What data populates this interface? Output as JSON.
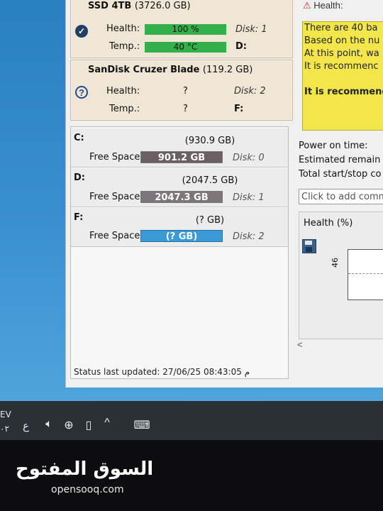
{
  "disks": [
    {
      "name": "SSD 4TB",
      "capacity": "(3726.0 GB)",
      "status_icon": "check-circle-icon",
      "health_label": "Health:",
      "health_value": "100 %",
      "temp_label": "Temp.:",
      "temp_value": "40 °C",
      "disk_label": "Disk: 1",
      "drive_label": "D:"
    },
    {
      "name": "SanDisk Cruzer Blade",
      "capacity": "(119.2 GB)",
      "status_icon": "question-circle-icon",
      "health_label": "Health:",
      "health_value": "?",
      "temp_label": "Temp.:",
      "temp_value": "?",
      "disk_label": "Disk: 2",
      "drive_label": "F:"
    }
  ],
  "volumes": [
    {
      "letter": "C:",
      "size": "(930.9 GB)",
      "free_label": "Free Space",
      "free_value": "901.2 GB",
      "disk": "Disk: 0",
      "bar_color": "#6b5f64"
    },
    {
      "letter": "D:",
      "size": "(2047.5 GB)",
      "free_label": "Free Space",
      "free_value": "2047.3 GB",
      "disk": "Disk: 1",
      "bar_color": "#7d757a"
    },
    {
      "letter": "F:",
      "size": "(? GB)",
      "free_label": "Free Space",
      "free_value": "(? GB)",
      "disk": "Disk: 2",
      "bar_color": "#3a9ad8"
    }
  ],
  "status": "Status last updated: 27/06/25 08:43:05 م",
  "right_panel": {
    "health_header": "Health:",
    "warning_lines": [
      "There are 40 ba",
      "Based on the nu",
      "At this point, wa",
      "It is recommenc",
      "",
      "It is recommenc"
    ],
    "power_on": "Power on time:",
    "estimated": "Estimated remain",
    "start_stop": "Total start/stop co",
    "comment_placeholder": "Click to add comm",
    "chart_title": "Health (%)",
    "y_value": "46",
    "scroll_left": "<"
  },
  "taskbar": {
    "lang_top": "EV",
    "lang_bottom": "٠٢",
    "ime": "ع",
    "icons": [
      "speaker-icon",
      "globe-icon",
      "battery-icon",
      "chevron-up-icon",
      "keyboard-icon"
    ]
  },
  "watermark": {
    "arabic": "السوق المفتوح",
    "latin": "opensooq.com"
  }
}
